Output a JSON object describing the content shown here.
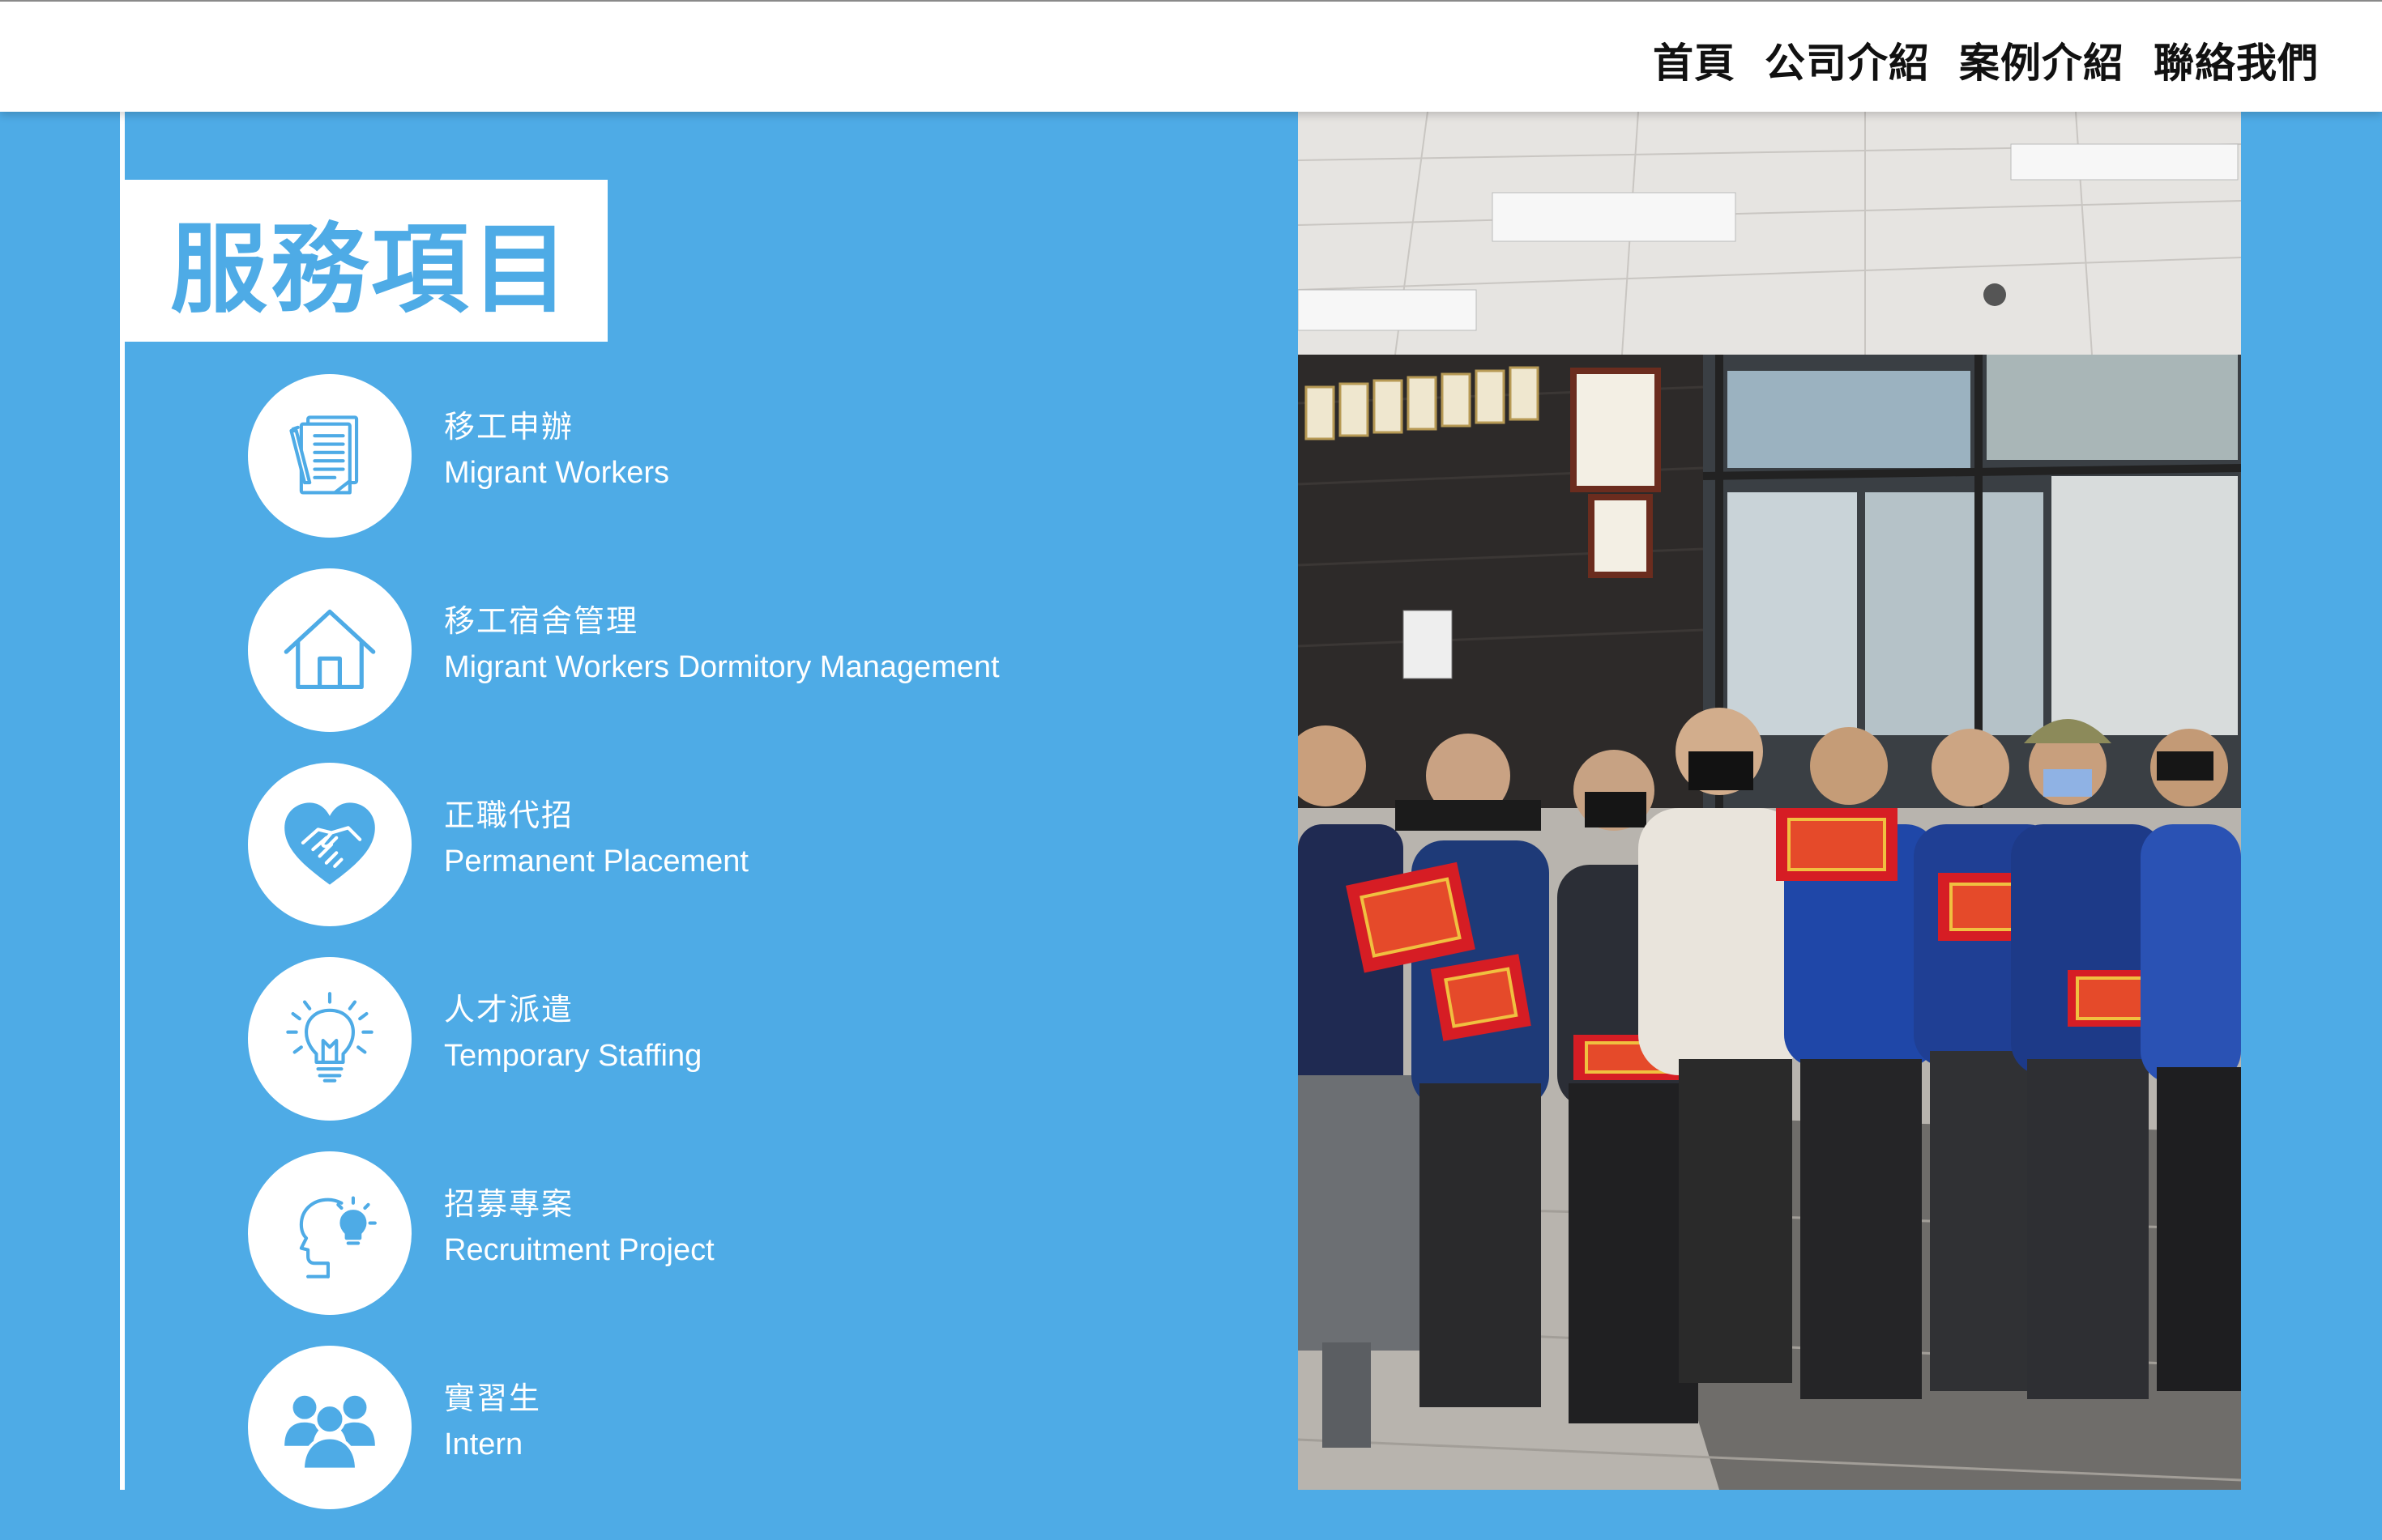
{
  "nav": {
    "items": [
      "首頁",
      "公司介紹",
      "案例介紹",
      "聯絡我們"
    ]
  },
  "section": {
    "title": "服務項目"
  },
  "services": [
    {
      "zh": "移工申辦",
      "en": "Migrant Workers",
      "icon": "document-icon"
    },
    {
      "zh": "移工宿舍管理",
      "en": "Migrant Workers Dormitory Management",
      "icon": "house-icon"
    },
    {
      "zh": "正職代招",
      "en": "Permanent Placement",
      "icon": "handshake-heart-icon"
    },
    {
      "zh": "人才派遣",
      "en": "Temporary Staffing",
      "icon": "lightbulb-icon"
    },
    {
      "zh": "招募專案",
      "en": "Recruitment Project",
      "icon": "head-idea-icon"
    },
    {
      "zh": "實習生",
      "en": "Intern",
      "icon": "people-group-icon"
    }
  ],
  "colors": {
    "accent": "#4eabe6",
    "nav_text": "#111111",
    "background_panel": "#ffffff"
  }
}
